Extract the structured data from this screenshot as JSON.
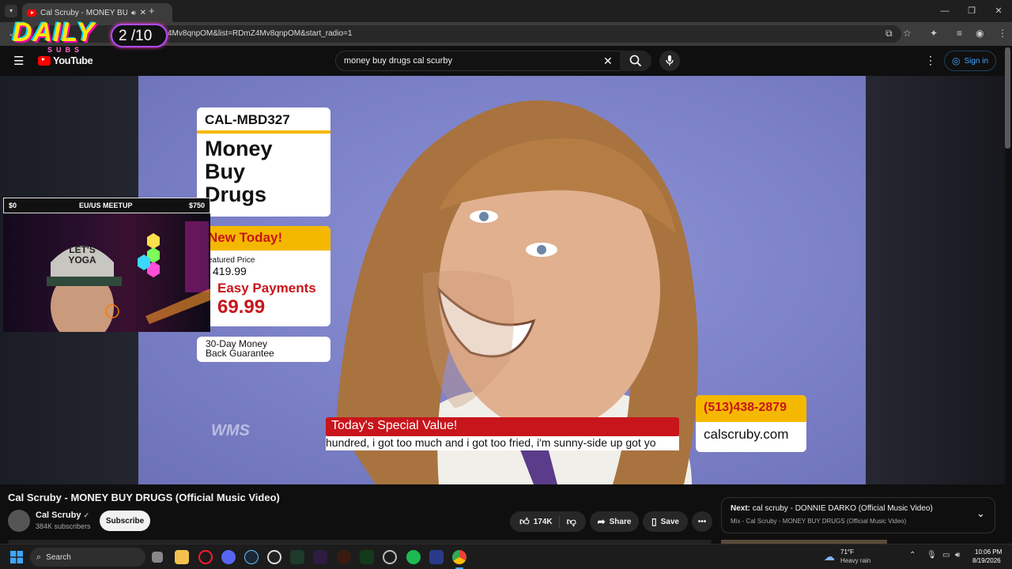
{
  "browser": {
    "tab_title": "Cal Scruby - MONEY BUY D",
    "url": "4Mv8qnpOM&list=RDmZ4Mv8qnpOM&start_radio=1",
    "new_tab": "+"
  },
  "overlay": {
    "logo_text": "DAILY",
    "logo_sub": "SUBS",
    "counter": "2 /10",
    "webcam_left": "$0",
    "webcam_title": "EU/US MEETUP",
    "webcam_right": "$750",
    "cap_text": "LET'S YOGA"
  },
  "youtube": {
    "logo_text": "YouTube",
    "search_value": "money buy drugs cal scurby",
    "sign_in": "Sign in"
  },
  "video": {
    "sku": "CAL-MBD327",
    "product_title_1": "Money",
    "product_title_2": "Buy",
    "product_title_3": "Drugs",
    "new_today": "New Today!",
    "featured_label": "eatured Price",
    "featured_price": "419.99",
    "easy_payments": "Easy Payments",
    "payment_price": "69.99",
    "guarantee_1": "30-Day Money",
    "guarantee_2": "Back Guarantee",
    "special_value": "Today's Special Value!",
    "subtitle": "hundred, i got too much and i got too fried, i'm sunny-side up got yo",
    "phone": "(513)438-2879",
    "website": "calscruby.com",
    "watermark": "WMS"
  },
  "info": {
    "title": "Cal Scruby - MONEY BUY DRUGS (Official Music Video)",
    "channel": "Cal Scruby",
    "subscribers": "384K subscribers",
    "subscribe": "Subscribe",
    "likes": "174K",
    "share": "Share",
    "save": "Save",
    "next_label": "Next:",
    "next_title": "cal scruby - DONNIE DARKO (Official Music Video)",
    "next_mix": "Mix - Cal Scruby - MONEY BUY DRUGS (Official Music Video)"
  },
  "taskbar": {
    "search": "Search",
    "weather_temp": "71°F",
    "weather_desc": "Heavy rain",
    "time": "10:06 PM",
    "date": "8/19/2026"
  },
  "colors": {
    "yt_red": "#ff0000",
    "card_yellow": "#f5b800",
    "banner_red": "#c8151b",
    "link_blue": "#3ea6ff"
  }
}
